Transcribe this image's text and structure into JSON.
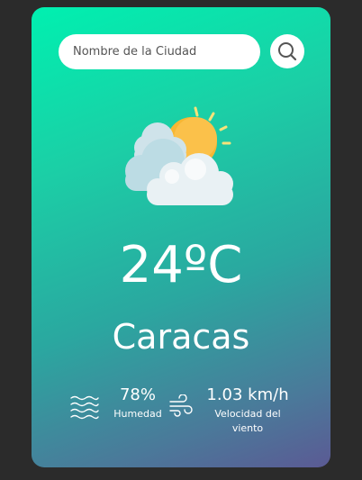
{
  "search": {
    "placeholder": "Nombre de la Ciudad",
    "value": "",
    "button_icon": "search-icon"
  },
  "weather": {
    "icon": "partly-cloudy-icon",
    "temperature": "24ºC",
    "city": "Caracas"
  },
  "details": {
    "humidity": {
      "icon": "humidity-waves-icon",
      "value": "78%",
      "label": "Humedad"
    },
    "wind": {
      "icon": "wind-icon",
      "value": "1.03 km/h",
      "label": "Velocidad del viento"
    }
  },
  "colors": {
    "background": "#2b2b2b",
    "gradient_start": "#00f0b0",
    "gradient_end": "#5b5a94",
    "text": "#ffffff",
    "sun": "#f7b733",
    "cloud": "#e8eef2"
  }
}
